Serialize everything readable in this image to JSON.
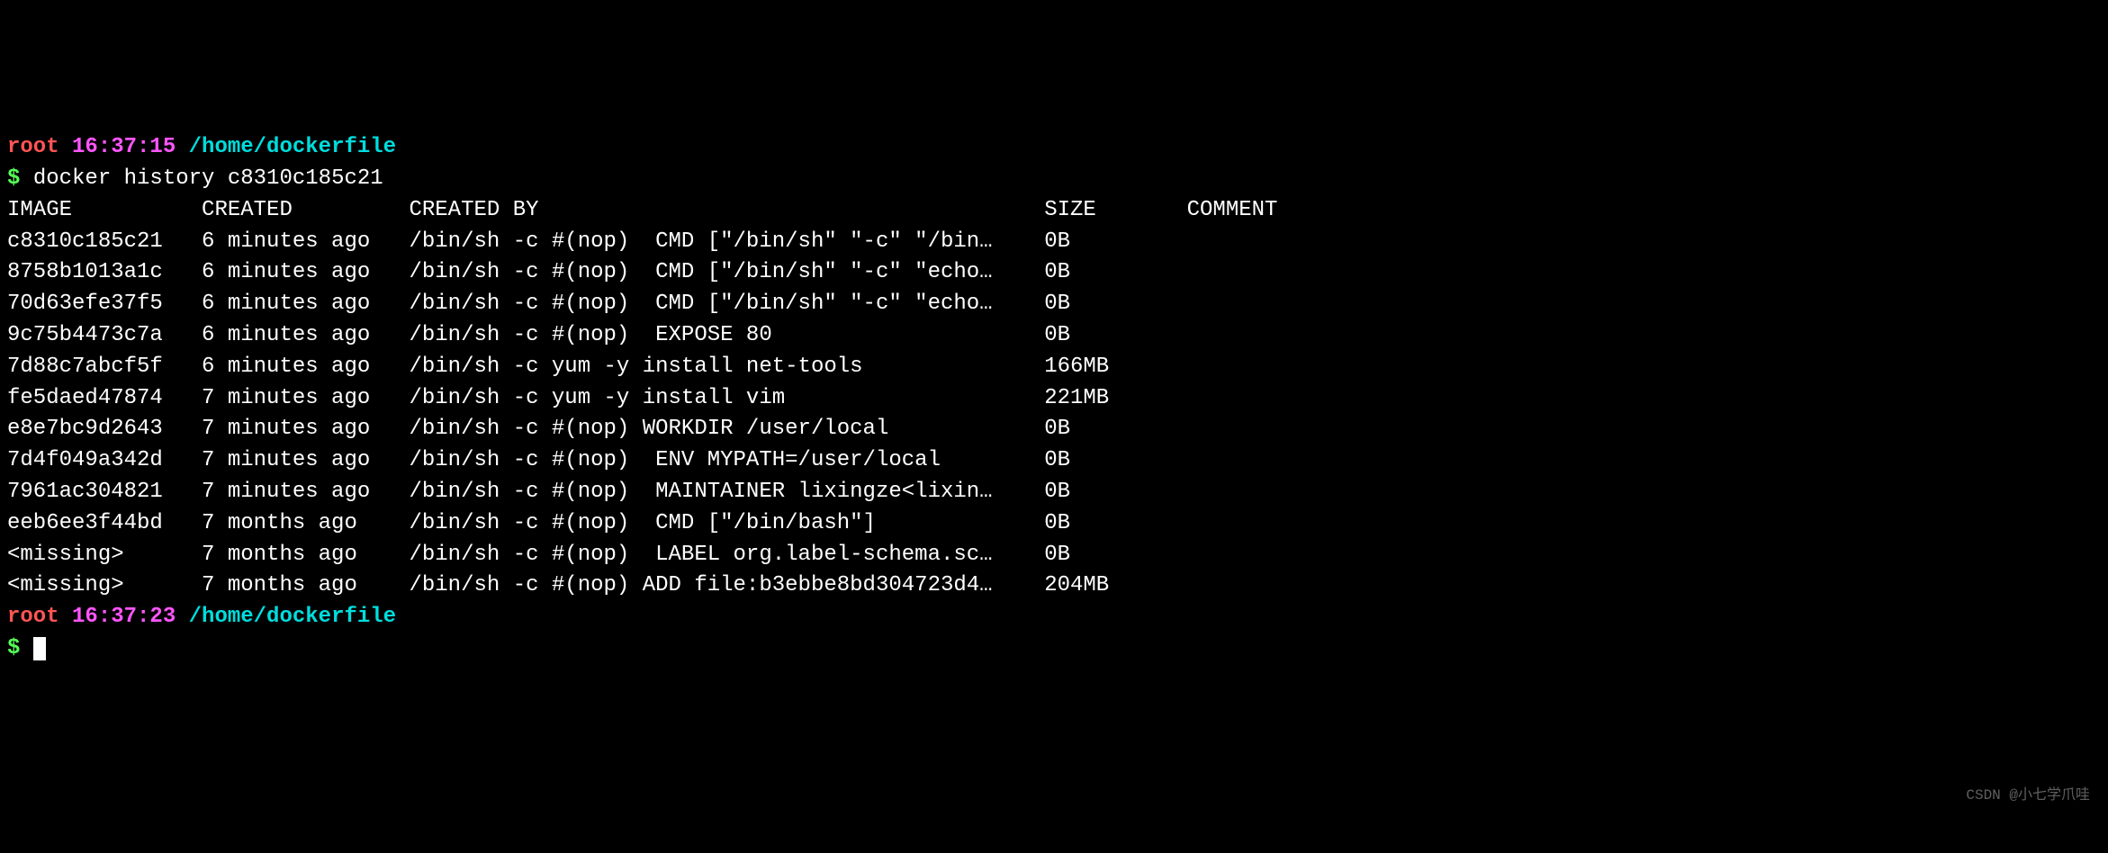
{
  "prompt1": {
    "user": "root",
    "time": "16:37:15",
    "path": "/home/dockerfile"
  },
  "command": "docker history c8310c185c21",
  "headers": {
    "image": "IMAGE",
    "created": "CREATED",
    "created_by": "CREATED BY",
    "size": "SIZE",
    "comment": "COMMENT"
  },
  "rows": [
    {
      "image": "c8310c185c21",
      "created": "6 minutes ago",
      "created_by": "/bin/sh -c #(nop)  CMD [\"/bin/sh\" \"-c\" \"/bin…",
      "size": "0B",
      "comment": ""
    },
    {
      "image": "8758b1013a1c",
      "created": "6 minutes ago",
      "created_by": "/bin/sh -c #(nop)  CMD [\"/bin/sh\" \"-c\" \"echo…",
      "size": "0B",
      "comment": ""
    },
    {
      "image": "70d63efe37f5",
      "created": "6 minutes ago",
      "created_by": "/bin/sh -c #(nop)  CMD [\"/bin/sh\" \"-c\" \"echo…",
      "size": "0B",
      "comment": ""
    },
    {
      "image": "9c75b4473c7a",
      "created": "6 minutes ago",
      "created_by": "/bin/sh -c #(nop)  EXPOSE 80",
      "size": "0B",
      "comment": ""
    },
    {
      "image": "7d88c7abcf5f",
      "created": "6 minutes ago",
      "created_by": "/bin/sh -c yum -y install net-tools",
      "size": "166MB",
      "comment": ""
    },
    {
      "image": "fe5daed47874",
      "created": "7 minutes ago",
      "created_by": "/bin/sh -c yum -y install vim",
      "size": "221MB",
      "comment": ""
    },
    {
      "image": "e8e7bc9d2643",
      "created": "7 minutes ago",
      "created_by": "/bin/sh -c #(nop) WORKDIR /user/local",
      "size": "0B",
      "comment": ""
    },
    {
      "image": "7d4f049a342d",
      "created": "7 minutes ago",
      "created_by": "/bin/sh -c #(nop)  ENV MYPATH=/user/local",
      "size": "0B",
      "comment": ""
    },
    {
      "image": "7961ac304821",
      "created": "7 minutes ago",
      "created_by": "/bin/sh -c #(nop)  MAINTAINER lixingze<lixin…",
      "size": "0B",
      "comment": ""
    },
    {
      "image": "eeb6ee3f44bd",
      "created": "7 months ago",
      "created_by": "/bin/sh -c #(nop)  CMD [\"/bin/bash\"]",
      "size": "0B",
      "comment": ""
    },
    {
      "image": "<missing>",
      "created": "7 months ago",
      "created_by": "/bin/sh -c #(nop)  LABEL org.label-schema.sc…",
      "size": "0B",
      "comment": ""
    },
    {
      "image": "<missing>",
      "created": "7 months ago",
      "created_by": "/bin/sh -c #(nop) ADD file:b3ebbe8bd304723d4…",
      "size": "204MB",
      "comment": ""
    }
  ],
  "prompt2": {
    "user": "root",
    "time": "16:37:23",
    "path": "/home/dockerfile"
  },
  "dollar": "$",
  "watermark": "CSDN @小七学爪哇"
}
